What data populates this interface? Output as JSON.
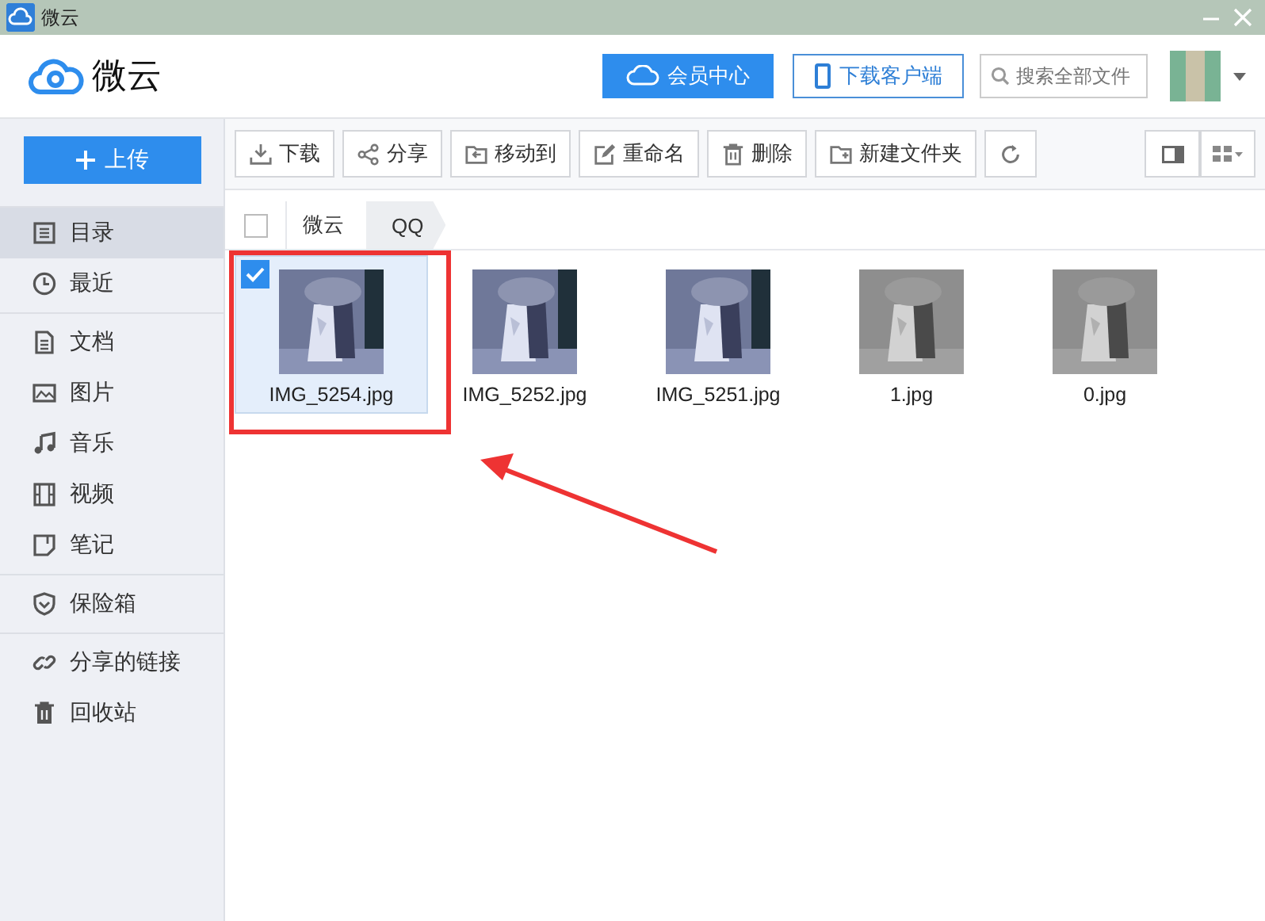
{
  "window": {
    "title": "微云"
  },
  "header": {
    "logo": "微云",
    "vip_button": "会员中心",
    "client_button": "下载客户端",
    "search": {
      "placeholder": "搜索全部文件"
    }
  },
  "upload_button": "上传",
  "toolbar": [
    {
      "label": "下载"
    },
    {
      "label": "分享"
    },
    {
      "label": "移动到"
    },
    {
      "label": "重命名"
    },
    {
      "label": "删除"
    },
    {
      "label": "新建文件夹"
    }
  ],
  "sidebar": {
    "groups": [
      {
        "items": [
          {
            "label": "目录",
            "selected": true
          },
          {
            "label": "最近",
            "selected": false
          }
        ]
      },
      {
        "items": [
          {
            "label": "文档",
            "selected": false
          },
          {
            "label": "图片",
            "selected": false
          },
          {
            "label": "音乐",
            "selected": false
          },
          {
            "label": "视频",
            "selected": false
          },
          {
            "label": "笔记",
            "selected": false
          }
        ]
      },
      {
        "items": [
          {
            "label": "保险箱",
            "selected": false
          }
        ]
      },
      {
        "items": [
          {
            "label": "分享的链接",
            "selected": false
          },
          {
            "label": "回收站",
            "selected": false
          }
        ]
      }
    ]
  },
  "breadcrumb": {
    "checked": false,
    "items": [
      "微云",
      "QQ"
    ]
  },
  "files": [
    {
      "name": "IMG_5254.jpg",
      "selected": true
    },
    {
      "name": "IMG_5252.jpg",
      "selected": false
    },
    {
      "name": "IMG_5251.jpg",
      "selected": false
    },
    {
      "name": "1.jpg",
      "selected": false
    },
    {
      "name": "0.jpg",
      "selected": false
    }
  ]
}
